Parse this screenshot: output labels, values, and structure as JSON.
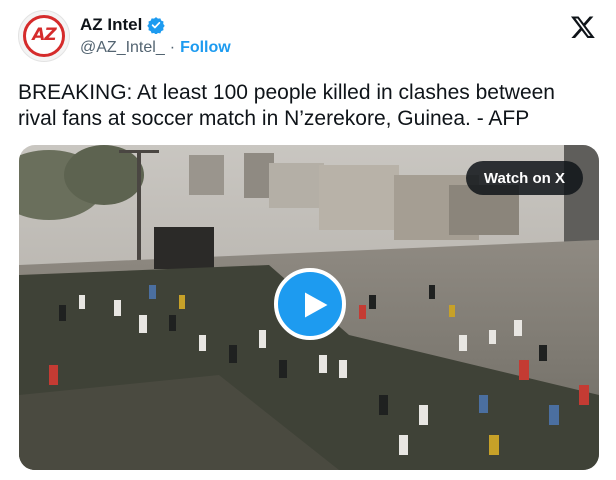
{
  "author": {
    "display_name": "AZ Intel",
    "handle": "@AZ_Intel_",
    "separator": "·",
    "follow_label": "Follow",
    "avatar_text": "AZ",
    "verified": true
  },
  "tweet": {
    "text": "BREAKING: At least 100 people killed in clashes between rival fans at soccer match in N’zerekore, Guinea. - AFP"
  },
  "media": {
    "watch_label": "Watch on X"
  },
  "colors": {
    "accent": "#1d9bf0",
    "text_primary": "#0f1419",
    "text_secondary": "#536471",
    "avatar_brand": "#d52b2b"
  },
  "icons": {
    "verified": "verified-badge-icon",
    "platform": "x-logo-icon",
    "play": "play-icon"
  }
}
